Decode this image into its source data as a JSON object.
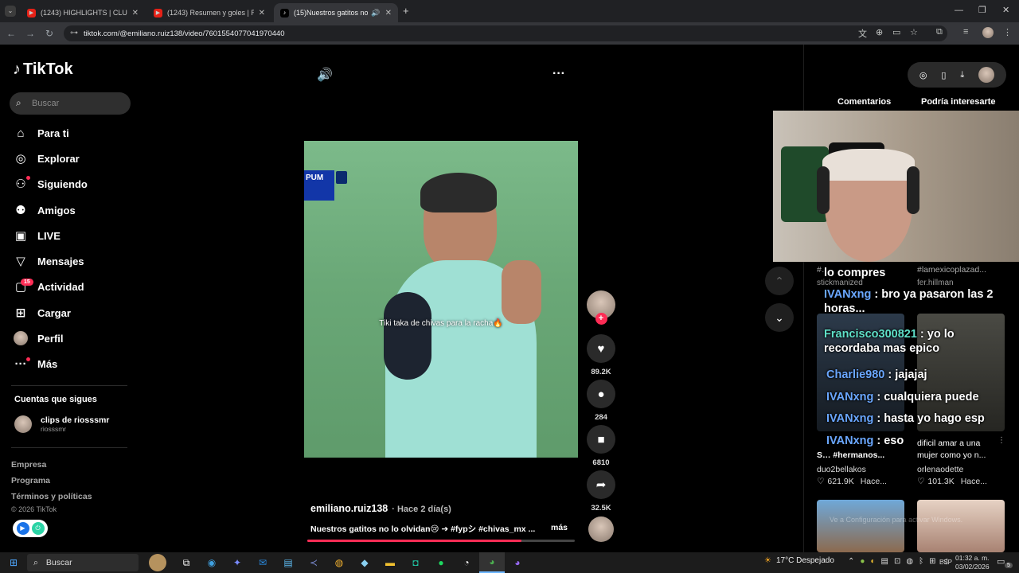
{
  "browser": {
    "tabs": [
      {
        "label": "(1243) HIGHLIGHTS | CLUB AMÉ",
        "favicon": "youtube-icon"
      },
      {
        "label": "(1243) Resumen y goles | Real M",
        "favicon": "youtube-icon"
      },
      {
        "label": "(15)Nuestros gatitos no lo o",
        "favicon": "tiktok-icon"
      }
    ],
    "url": "tiktok.com/@emiliano.ruiz138/video/7601554077041970440"
  },
  "tiktok": {
    "logo": "TikTok",
    "search_placeholder": "Buscar",
    "nav": [
      {
        "label": "Para ti",
        "icon": "home-icon"
      },
      {
        "label": "Explorar",
        "icon": "compass-icon"
      },
      {
        "label": "Siguiendo",
        "icon": "following-icon"
      },
      {
        "label": "Amigos",
        "icon": "friends-icon"
      },
      {
        "label": "LIVE",
        "icon": "live-icon"
      },
      {
        "label": "Mensajes",
        "icon": "messages-icon"
      },
      {
        "label": "Actividad",
        "icon": "activity-icon",
        "badge": "15"
      },
      {
        "label": "Cargar",
        "icon": "upload-icon"
      },
      {
        "label": "Perfil",
        "icon": "profile-icon"
      },
      {
        "label": "Más",
        "icon": "more-icon"
      }
    ],
    "following_title": "Cuentas que sigues",
    "following": [
      {
        "name": "clips de riosssmr",
        "handle": "riosssmr"
      }
    ],
    "footer": [
      "Empresa",
      "Programa",
      "Términos y políticas"
    ],
    "copyright": "© 2026 TikTok",
    "video": {
      "caption_overlay": "Tiki taka de chivas para la racha🔥",
      "scoreboard": "PUM",
      "author": "emiliano.ruiz138",
      "time": "· Hace 2 día(s)",
      "description": "Nuestros gatitos no lo olvidan😢 ➔ #fypシ #chivas_mx ...",
      "more": "más",
      "likes": "89.2K",
      "comments": "284",
      "saves": "6810",
      "shares": "32.5K"
    },
    "right_tabs": [
      "Comentarios",
      "Podría interesarte"
    ],
    "cards": [
      {
        "tag": "#…",
        "author": "stickmanized"
      },
      {
        "tag": "#lamexicoplazad...",
        "author": "fer.hillman"
      },
      {
        "title": "S… #hermanos...",
        "author": "duo2bellakos",
        "likes": "621.9K",
        "time": "Hace..."
      },
      {
        "title": "dificil amar a una mujer como yo n...",
        "author": "orlenaodette",
        "likes": "101.3K",
        "time": "Hace..."
      }
    ],
    "chat": [
      {
        "user": "",
        "text": "lo compres"
      },
      {
        "user": "IVANxng",
        "text": ": bro ya pasaron las 2 horas..."
      },
      {
        "user": "Francisco300821",
        "text": ": yo lo recordaba mas epico"
      },
      {
        "user": "Charlie980",
        "text": ": jajajaj"
      },
      {
        "user": "IVANxng",
        "text": ": cualquiera puede"
      },
      {
        "user": "IVANxng",
        "text": ": hasta yo hago esp"
      },
      {
        "user": "IVANxng",
        "text": ": eso"
      }
    ],
    "watermark": "Ve a Configuración para activar Windows."
  },
  "taskbar": {
    "search": "Buscar",
    "weather": "17°C  Despejado",
    "lang": "ESP",
    "time": "01:32 a. m.",
    "date": "03/02/2026",
    "notifications": "5"
  },
  "colors": {
    "accent": "#fe2c55",
    "chat_blue": "#6aa7ff",
    "chat_teal": "#5fe0c8"
  }
}
